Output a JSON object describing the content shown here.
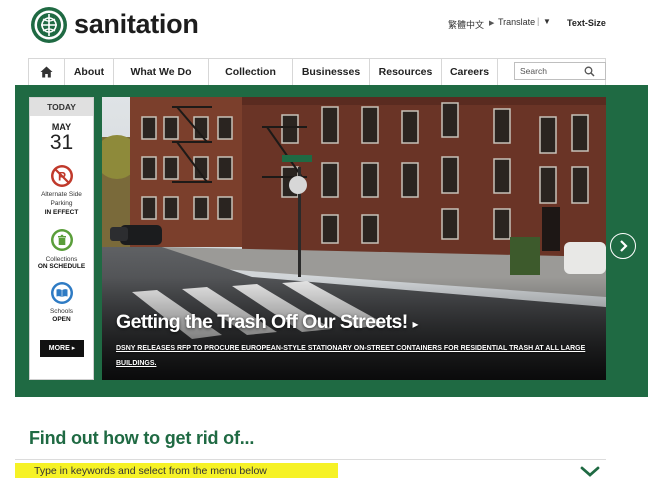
{
  "header": {
    "brand": "sanitation",
    "language": "繁體中文",
    "translate": "Translate",
    "translate_sep": "|",
    "translate_caret": "▼",
    "text_size": "Text-Size"
  },
  "nav": {
    "items": [
      "About",
      "What We Do",
      "Collection",
      "Businesses",
      "Resources",
      "Careers"
    ],
    "search_placeholder": "Search"
  },
  "today": {
    "header": "TODAY",
    "month": "MAY",
    "day": "31",
    "stats": [
      {
        "label": "Alternate Side Parking",
        "value": "IN EFFECT",
        "icon": "no-parking-icon",
        "color": "#c0392b"
      },
      {
        "label": "Collections",
        "value": "ON SCHEDULE",
        "icon": "trash-can-icon",
        "color": "#5a9e3a"
      },
      {
        "label": "Schools",
        "value": "OPEN",
        "icon": "book-icon",
        "color": "#2e7bc4"
      }
    ],
    "more_label": "MORE"
  },
  "hero": {
    "title": "Getting the Trash Off Our Streets!",
    "subtitle": "DSNY RELEASES RFP TO PROCURE EUROPEAN-STYLE STATIONARY ON-STREET CONTAINERS FOR RESIDENTIAL TRASH AT ALL LARGE BUILDINGS."
  },
  "find": {
    "title": "Find out how to get rid of...",
    "placeholder": "Type in keywords and select from the menu below"
  },
  "colors": {
    "brand_green": "#1f6a43",
    "highlight": "#f4f000"
  }
}
